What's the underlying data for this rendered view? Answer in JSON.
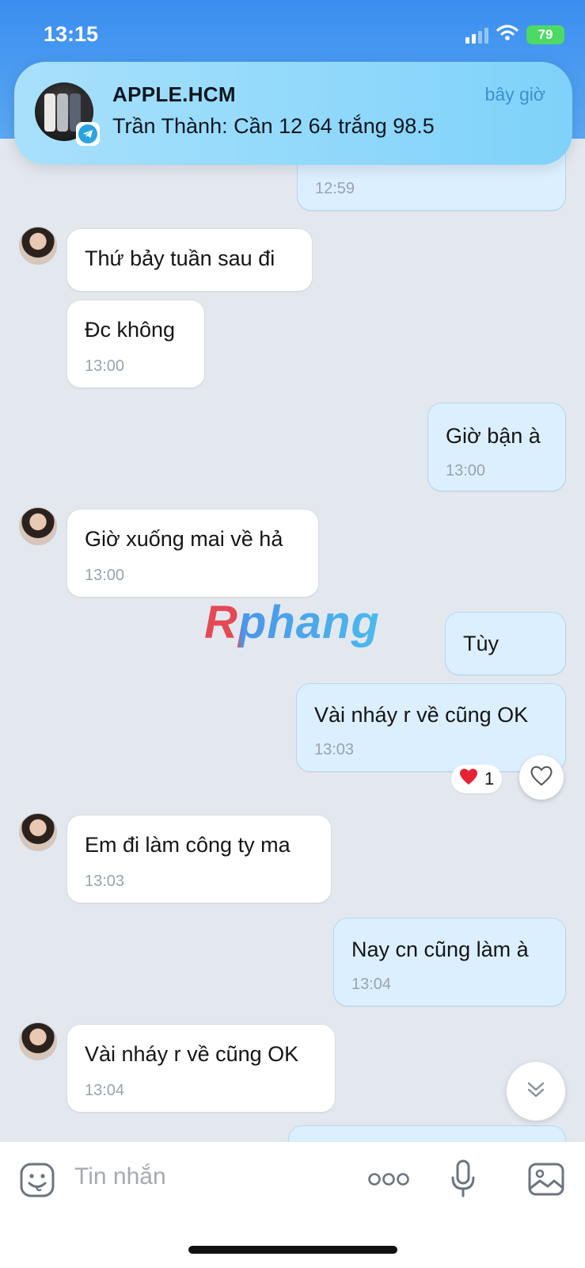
{
  "status": {
    "time": "13:15",
    "battery": "79"
  },
  "notification": {
    "title": "APPLE.HCM",
    "time": "bây giờ",
    "body": "Trần Thành: Cần 12 64 trắng 98.5"
  },
  "messages": [
    {
      "dir": "out",
      "time": "12:59"
    },
    {
      "dir": "in",
      "text": "Thứ bảy tuần sau đi"
    },
    {
      "dir": "in",
      "text": "Đc không",
      "time": "13:00"
    },
    {
      "dir": "out",
      "text": "Giờ bận à",
      "time": "13:00"
    },
    {
      "dir": "in",
      "text": "Giờ xuống mai về hả",
      "time": "13:00"
    },
    {
      "dir": "out",
      "text": "Tùy"
    },
    {
      "dir": "out",
      "text": "Vài nháy r về cũng OK",
      "time": "13:03",
      "reaction_count": "1"
    },
    {
      "dir": "in",
      "text": "Em đi làm công ty ma",
      "time": "13:03"
    },
    {
      "dir": "out",
      "text": "Nay cn cũng làm à",
      "time": "13:04"
    },
    {
      "dir": "in",
      "text": "Vài nháy r về cũng OK",
      "time": "13:04"
    }
  ],
  "watermark": "Rphang",
  "input": {
    "placeholder": "Tin nhắn"
  },
  "colors": {
    "header_blue": "#3a8ef0",
    "out_bubble": "#dcefff",
    "in_bubble": "#ffffff",
    "chat_bg": "#e3e8ef"
  },
  "icons": [
    "wifi-icon",
    "signal-icon",
    "telegram-icon",
    "heart-icon",
    "chevron-double-down-icon",
    "sticker-icon",
    "more-icon",
    "microphone-icon",
    "gallery-icon"
  ]
}
